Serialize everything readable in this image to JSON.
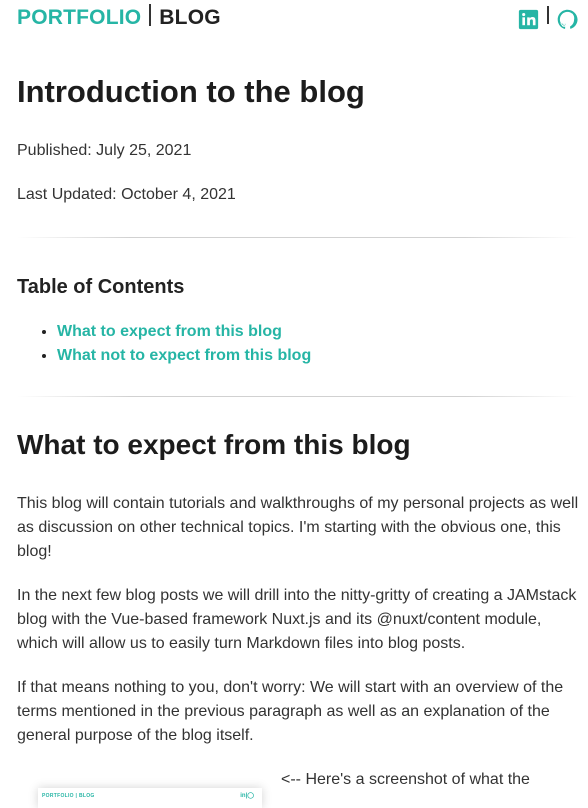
{
  "nav": {
    "portfolio": "PORTFOLIO",
    "blog": "BLOG",
    "linkedin_icon": "linkedin-icon",
    "github_icon": "github-icon",
    "accent": "#26b5a5"
  },
  "post": {
    "title": "Introduction to the blog",
    "published": "Published: July 25, 2021",
    "updated": "Last Updated: October 4, 2021"
  },
  "toc": {
    "title": "Table of Contents",
    "items": [
      "What to expect from this blog",
      "What not to expect from this blog"
    ]
  },
  "section1": {
    "heading": "What to expect from this blog",
    "p1": "This blog will contain tutorials and walkthroughs of my personal projects as well as discussion on other technical topics. I'm starting with the obvious one, this blog!",
    "p2": "In the next few blog posts we will drill into the nitty-gritty of creating a JAMstack blog with the Vue-based framework Nuxt.js and its @nuxt/content module, which will allow us to easily turn Markdown files into blog posts.",
    "p3": "If that means nothing to you, don't worry: We will start with an overview of the terms mentioned in the previous paragraph as well as an explanation of the general purpose of the blog itself.",
    "caption": "<-- Here's a screenshot of what the"
  },
  "screenshot": {
    "mini_nav": "PORTFOLIO | BLOG"
  }
}
